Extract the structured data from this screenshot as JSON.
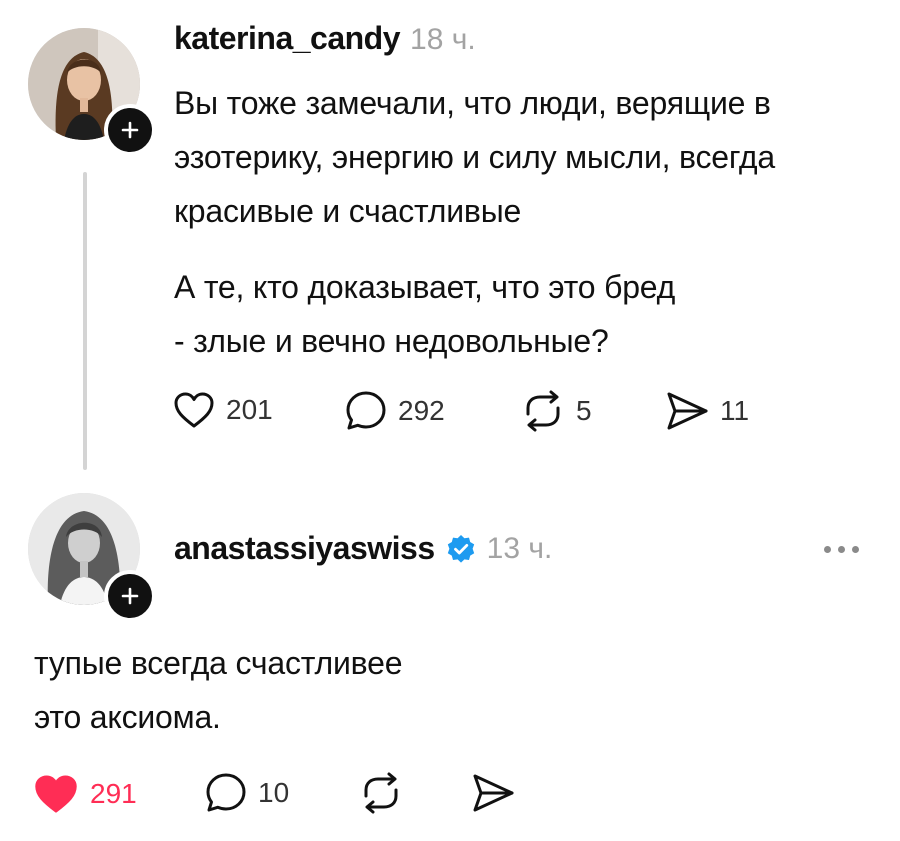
{
  "post": {
    "username": "katerina_candy",
    "time": "18 ч.",
    "paragraph1": [
      "Вы тоже замечали, что люди, верящие в",
      "эзотерику, энергию и силу мысли, всегда",
      "красивые и счастливые"
    ],
    "paragraph2": [
      "А те, кто доказывает, что это бред",
      "- злые и вечно недовольные?"
    ],
    "likes": "201",
    "comments": "292",
    "reposts": "5",
    "shares": "11"
  },
  "reply": {
    "username": "anastassiyaswiss",
    "time": "13 ч.",
    "lines": [
      "тупые всегда счастливее",
      "это аксиома."
    ],
    "likes": "291",
    "comments": "10",
    "liked": true
  },
  "colors": {
    "like_active": "#ff2d55",
    "verified": "#1d9bf0",
    "thread_line": "#d4d4d4"
  },
  "icons": [
    "heart-icon",
    "comment-icon",
    "repost-icon",
    "share-icon",
    "plus-icon",
    "verified-badge-icon",
    "more-options-icon"
  ]
}
